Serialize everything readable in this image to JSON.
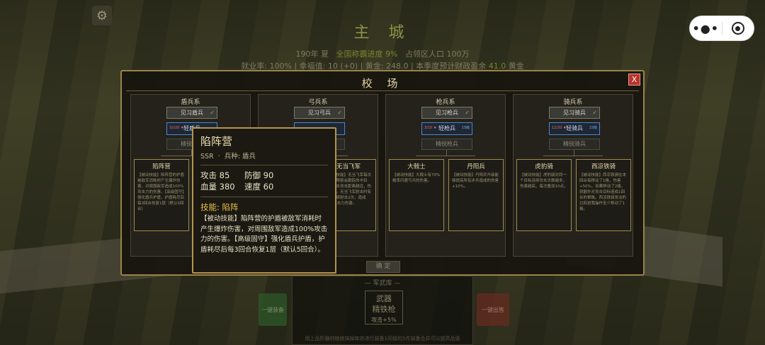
{
  "header": {
    "city_title": "主 城",
    "line1": {
      "year": "190年 夏",
      "progress_label": "全国称霸进度",
      "progress_value": "9%",
      "population": "占领区人口 100万"
    },
    "line2": {
      "employment": "就业率: 100%",
      "happiness": "幸福值: 10 (+0)",
      "gold": "黄金: 248.0",
      "forecast_label": "本季度预计财政盈余",
      "forecast_value": "41.0",
      "forecast_unit": "黄金"
    }
  },
  "capsule": {
    "more_glyph": "•●•",
    "record_icon": "record-icon"
  },
  "settings_icon": "gear-icon",
  "dialog": {
    "title": "校 场",
    "close_label": "X",
    "confirm_label": "确 定",
    "columns": [
      {
        "title": "盾兵系",
        "basic": "见习盾兵",
        "current": "轻盾兵",
        "current_hp": "10/20 ♦",
        "current_lv": "",
        "locked": "精锐盾兵",
        "cards": [
          {
            "name": "陷阵营",
            "text": "【被动技能】陷阵营的护盾被敌军消耗时产生爆炸伤害，对周围敌军造成100%攻击力的伤害。【高级固守】强化盾兵护盾，护盾耗尽后每3回合恢复1层（默认5回合）"
          },
          {
            "name": "",
            "text": ""
          }
        ]
      },
      {
        "title": "弓兵系",
        "basic": "见习弓兵",
        "current": "",
        "current_hp": "",
        "current_lv": "",
        "locked": "",
        "cards": [
          {
            "name": "",
            "text": ""
          },
          {
            "name": "无当飞军",
            "text": "【被动技能】无当飞军每次攻击的弩箭会跟踪命中目标，射击攻击距离越远，伤害越高。无当飞军射击时有概率连续射击2次，造成80%攻击力伤害。"
          }
        ]
      },
      {
        "title": "枪兵系",
        "basic": "见习枪兵",
        "current": "轻枪兵",
        "current_hp": "3/10 ♦",
        "current_lv": "1S级",
        "locked": "精锐枪兵",
        "cards": [
          {
            "name": "大戟士",
            "text": "【被动技能】大戟士有70%概率闪避弓兵的伤害。"
          },
          {
            "name": "丹阳兵",
            "text": "【被动技能】丹阳兵升级能够提高所有步兵造成的伤害+10%。"
          }
        ]
      },
      {
        "title": "骑兵系",
        "basic": "见习骑兵",
        "current": "轻骑兵",
        "current_hp": "12/20 ♦",
        "current_lv": "1S级",
        "locked": "精锐骑兵",
        "cards": [
          {
            "name": "虎豹骑",
            "text": "【被动技能】虎豹骑对同一个目标连续攻击次数越多，伤害越高，每次叠加10点。"
          },
          {
            "name": "西凉铁骑",
            "text": "【被动技能】西凉铁骑在本回合每移动了1格，伤害+50%。如果移动了2格，就额外对攻击目标造成1回合的晕眩。西凉铁骑发动的过四进我操作至少移动了1格。"
          }
        ]
      }
    ]
  },
  "tooltip": {
    "name": "陷阵营",
    "rarity": "SSR",
    "dot": "·",
    "type": "兵种: 盾兵",
    "attack": "攻击 85",
    "defense": "防御 90",
    "hp": "血量 380",
    "speed": "速度 60",
    "skill": "技能: 陷阵",
    "description": "【被动技能】陷阵营的护盾被敌军消耗时产生爆炸伤害，对周围敌军造成100%攻击力的伤害。【高级固守】强化盾兵护盾，护盾耗尽后每3回合恢复1层（默认5回合）。"
  },
  "armory": {
    "header": "— 军武库 —",
    "weapon_type": "武器",
    "weapon_name": "精铁枪",
    "weapon_bonus": "攻击+5%",
    "equip_label": "一键装备",
    "sell_label": "一键出售",
    "note": "用上品阶器材统统抹掉库存进行装备1同级的5件装备合并可以提高品级"
  },
  "colors": {
    "accent": "#b39550",
    "close_red": "#b8342b",
    "active_blue": "#4c85d4",
    "skill_gold": "#e7c14d"
  }
}
